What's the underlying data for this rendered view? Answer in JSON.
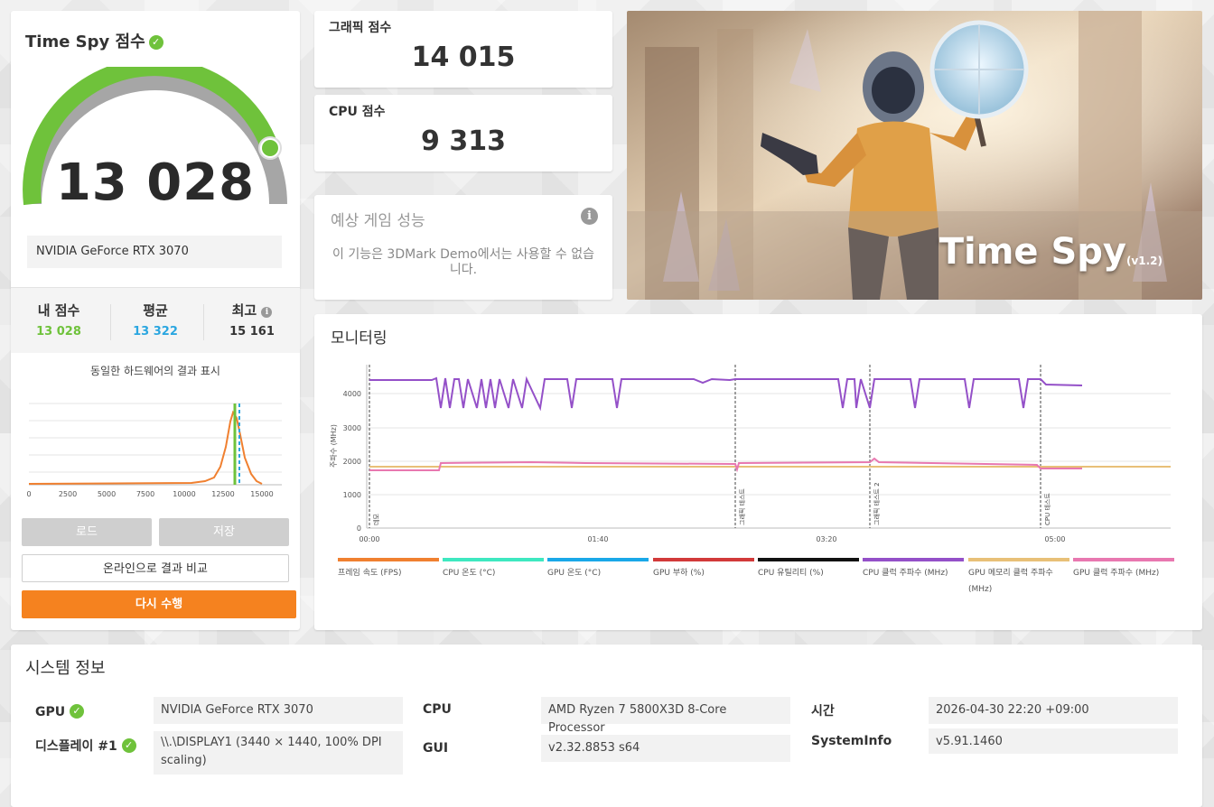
{
  "score_panel": {
    "title": "Time Spy 점수",
    "score": "13 028",
    "gpu_name": "NVIDIA GeForce RTX 3070",
    "stats": [
      {
        "label": "내 점수",
        "value": "13 028",
        "color": "#6fc23b"
      },
      {
        "label": "평균",
        "value": "13 322",
        "color": "#2aa6e0"
      },
      {
        "label": "최고",
        "value": "15 161",
        "color": "#333333"
      }
    ],
    "histogram_title": "동일한 하드웨어의 결과 표시",
    "histogram_ticks": [
      "0",
      "2500",
      "5000",
      "7500",
      "10000",
      "12500",
      "15000"
    ],
    "load_label": "로드",
    "save_label": "저장",
    "compare_label": "온라인으로 결과 비교",
    "rerun_label": "다시 수행"
  },
  "graphics_card": {
    "title": "그래픽 점수",
    "value": "14 015"
  },
  "cpu_card": {
    "title": "CPU 점수",
    "value": "9 313"
  },
  "estimate_card": {
    "title": "예상 게임 성능",
    "text": "이 기능은 3DMark Demo에서는 사용할 수 없습니다."
  },
  "banner": {
    "title": "Time Spy",
    "version": "(v1.2)"
  },
  "monitoring": {
    "title": "모니터링",
    "y_axis_label": "주파수 (MHz)",
    "y_ticks": [
      "0",
      "1000",
      "2000",
      "3000",
      "4000"
    ],
    "x_ticks": [
      "00:00",
      "01:40",
      "03:20",
      "05:00"
    ],
    "markers": [
      "데모",
      "그래픽 테스트",
      "그래픽 테스트 2",
      "CPU 테스트"
    ],
    "legend": [
      {
        "label": "프레임 속도 (FPS)",
        "color": "#f08030"
      },
      {
        "label": "CPU 온도 (°C)",
        "color": "#3ee8c0"
      },
      {
        "label": "GPU 온도 (°C)",
        "color": "#1aa8e8"
      },
      {
        "label": "GPU 부하 (%)",
        "color": "#d23a3a"
      },
      {
        "label": "CPU 유틸리티 (%)",
        "color": "#111111"
      },
      {
        "label": "CPU 클럭 주파수 (MHz)",
        "color": "#9450c8"
      },
      {
        "label": "GPU 메모리 클럭 주파수 (MHz)",
        "color": "#e8c078"
      },
      {
        "label": "GPU 클럭 주파수 (MHz)",
        "color": "#e878b0"
      }
    ]
  },
  "system_info": {
    "title": "시스템 정보",
    "gpu_label": "GPU",
    "gpu_value": "NVIDIA GeForce RTX 3070",
    "display_label": "디스플레이 #1",
    "display_value": "\\\\.\\DISPLAY1 (3440 × 1440, 100% DPI scaling)",
    "cpu_label": "CPU",
    "cpu_value": "AMD Ryzen 7 5800X3D 8-Core Processor",
    "gui_label": "GUI",
    "gui_value": "v2.32.8853 s64",
    "time_label": "시간",
    "time_value": "2026-04-30 22:20 +09:00",
    "sysinfo_label": "SystemInfo",
    "sysinfo_value": "v5.91.1460"
  }
}
